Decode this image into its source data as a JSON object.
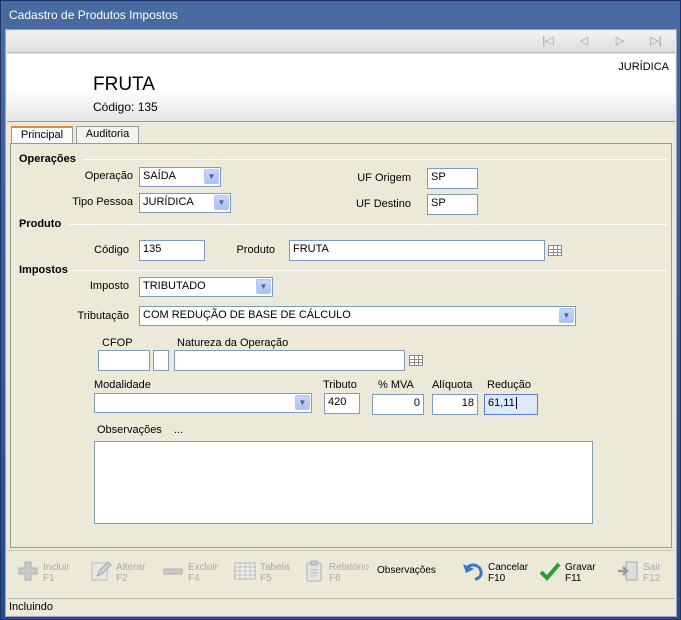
{
  "window": {
    "title": "Cadastro de Produtos Impostos"
  },
  "nav": {
    "first": "|◁",
    "prev": "◁",
    "next": "▷",
    "last": "▷|"
  },
  "header": {
    "product_name": "FRUTA",
    "product_code": "Código: 135",
    "person_type": "JURÍDICA"
  },
  "tabs": [
    {
      "label": "Principal",
      "active": true
    },
    {
      "label": "Auditoria",
      "active": false
    }
  ],
  "operacoes": {
    "title": "Operações",
    "operacao_label": "Operação",
    "operacao_value": "SAÍDA",
    "tipo_pessoa_label": "Tipo Pessoa",
    "tipo_pessoa_value": "JURÍDICA",
    "uf_origem_label": "UF Origem",
    "uf_origem_value": "SP",
    "uf_destino_label": "UF Destino",
    "uf_destino_value": "SP"
  },
  "produto": {
    "title": "Produto",
    "codigo_label": "Código",
    "codigo_value": "135",
    "produto_label": "Produto",
    "produto_value": "FRUTA"
  },
  "impostos": {
    "title": "Impostos",
    "imposto_label": "Imposto",
    "imposto_value": "TRIBUTADO",
    "tributacao_label": "Tributação",
    "tributacao_value": "COM REDUÇÃO DE BASE DE CÁLCULO",
    "cfop_label": "CFOP",
    "cfop_value": "",
    "cfop_digit": "",
    "natureza_label": "Natureza da Operação",
    "natureza_value": "",
    "modalidade_label": "Modalidade",
    "modalidade_value": "",
    "tributo_label": "Tributo",
    "tributo_value": "420",
    "mva_label": "% MVA",
    "mva_value": "0",
    "aliquota_label": "Alíquota",
    "aliquota_value": "18",
    "reducao_label": "Redução",
    "reducao_value": "61,11",
    "observacoes_label": "Observações",
    "observacoes_ellipsis": "...",
    "observacoes_value": ""
  },
  "toolbar": [
    {
      "label": "Incluir",
      "key": "F1",
      "icon": "plus-icon",
      "enabled": false
    },
    {
      "label": "Alterar",
      "key": "F2",
      "icon": "pencil-icon",
      "enabled": false
    },
    {
      "label": "Excluir",
      "key": "F4",
      "icon": "minus-icon",
      "enabled": false
    },
    {
      "label": "Tabela",
      "key": "F5",
      "icon": "table-icon",
      "enabled": false
    },
    {
      "label": "Relatório",
      "key": "F6",
      "icon": "report-icon",
      "enabled": false
    },
    {
      "label": "Observações",
      "key": "",
      "icon": "",
      "enabled": true
    },
    {
      "label": "Cancelar",
      "key": "F10",
      "icon": "undo-icon",
      "enabled": true
    },
    {
      "label": "Gravar",
      "key": "F11",
      "icon": "check-icon",
      "enabled": true
    },
    {
      "label": "Sair",
      "key": "F12",
      "icon": "exit-icon",
      "enabled": false
    }
  ],
  "status": {
    "text": "Incluindo"
  }
}
